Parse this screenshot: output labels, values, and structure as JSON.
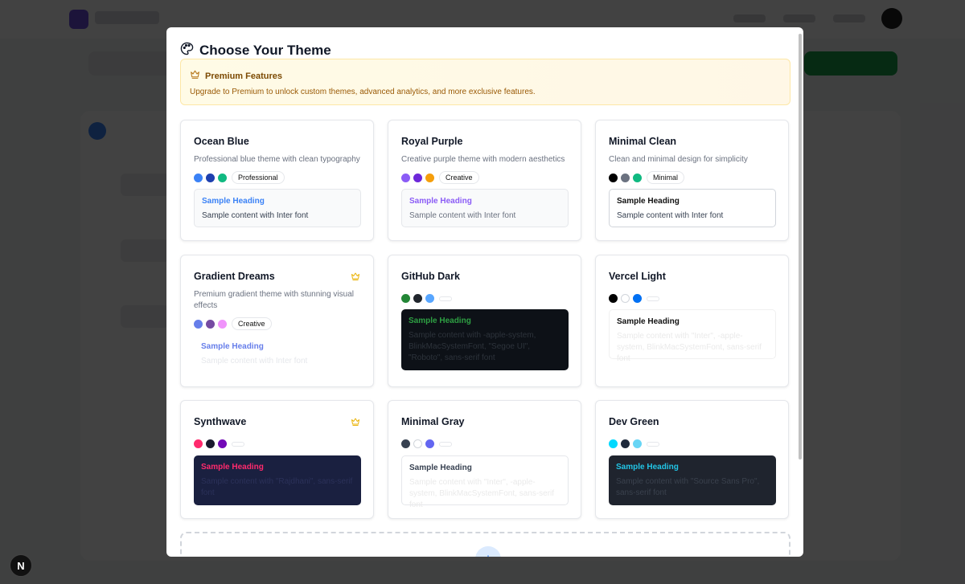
{
  "modal": {
    "title": "Choose Your Theme",
    "premium": {
      "title": "Premium Features",
      "text": "Upgrade to Premium to unlock custom themes, advanced analytics, and more exclusive features."
    }
  },
  "themes": [
    {
      "name": "Ocean Blue",
      "description": "Professional blue theme with clean typography",
      "premium": false,
      "colors": [
        "#3b82f6",
        "#1e40af",
        "#10b981"
      ],
      "tag": "Professional",
      "preview_heading": "Sample Heading",
      "preview_body": "Sample content with Inter font"
    },
    {
      "name": "Royal Purple",
      "description": "Creative purple theme with modern aesthetics",
      "premium": false,
      "colors": [
        "#8b5cf6",
        "#6d28d9",
        "#f59e0b"
      ],
      "tag": "Creative",
      "preview_heading": "Sample Heading",
      "preview_body": "Sample content with Inter font"
    },
    {
      "name": "Minimal Clean",
      "description": "Clean and minimal design for simplicity",
      "premium": false,
      "colors": [
        "#000000",
        "#6b7280",
        "#10b981"
      ],
      "tag": "Minimal",
      "preview_heading": "Sample Heading",
      "preview_body": "Sample content with Inter font"
    },
    {
      "name": "Gradient Dreams",
      "description": "Premium gradient theme with stunning visual effects",
      "premium": true,
      "colors": [
        "#667eea",
        "#764ba2",
        "#f093fb"
      ],
      "tag": "Creative",
      "preview_heading": "Sample Heading",
      "preview_body": "Sample content with Inter font"
    },
    {
      "name": "GitHub Dark",
      "description": "",
      "premium": false,
      "colors": [
        "#238636",
        "#21262d",
        "#58a6ff"
      ],
      "tag": "",
      "preview_heading": "Sample Heading",
      "preview_body": "Sample content with -apple-system, BlinkMacSystemFont, \"Segoe UI\", \"Roboto\", sans-serif font"
    },
    {
      "name": "Vercel Light",
      "description": "",
      "premium": false,
      "colors": [
        "#000000",
        "#ffffff",
        "#0070f3"
      ],
      "tag": "",
      "preview_heading": "Sample Heading",
      "preview_body": "Sample content with \"Inter\", -apple-system, BlinkMacSystemFont, sans-serif font"
    },
    {
      "name": "Synthwave",
      "description": "",
      "premium": true,
      "colors": [
        "#ff2a6d",
        "#1a1a2e",
        "#7209b7"
      ],
      "tag": "",
      "preview_heading": "Sample Heading",
      "preview_body": "Sample content with \"Rajdhani\", sans-serif font"
    },
    {
      "name": "Minimal Gray",
      "description": "",
      "premium": false,
      "colors": [
        "#374151",
        "#ffffff",
        "#6366f1"
      ],
      "tag": "",
      "preview_heading": "Sample Heading",
      "preview_body": "Sample content with \"Inter\", -apple-system, BlinkMacSystemFont, sans-serif font"
    },
    {
      "name": "Dev Green",
      "description": "",
      "premium": false,
      "colors": [
        "#00d9ff",
        "#1e293b",
        "#67d5f5"
      ],
      "tag": "",
      "preview_heading": "Sample Heading",
      "preview_body": "Sample content with \"Source Sans Pro\", sans-serif font"
    }
  ],
  "add_theme": {
    "icon": "+"
  },
  "framework_badge": "N"
}
